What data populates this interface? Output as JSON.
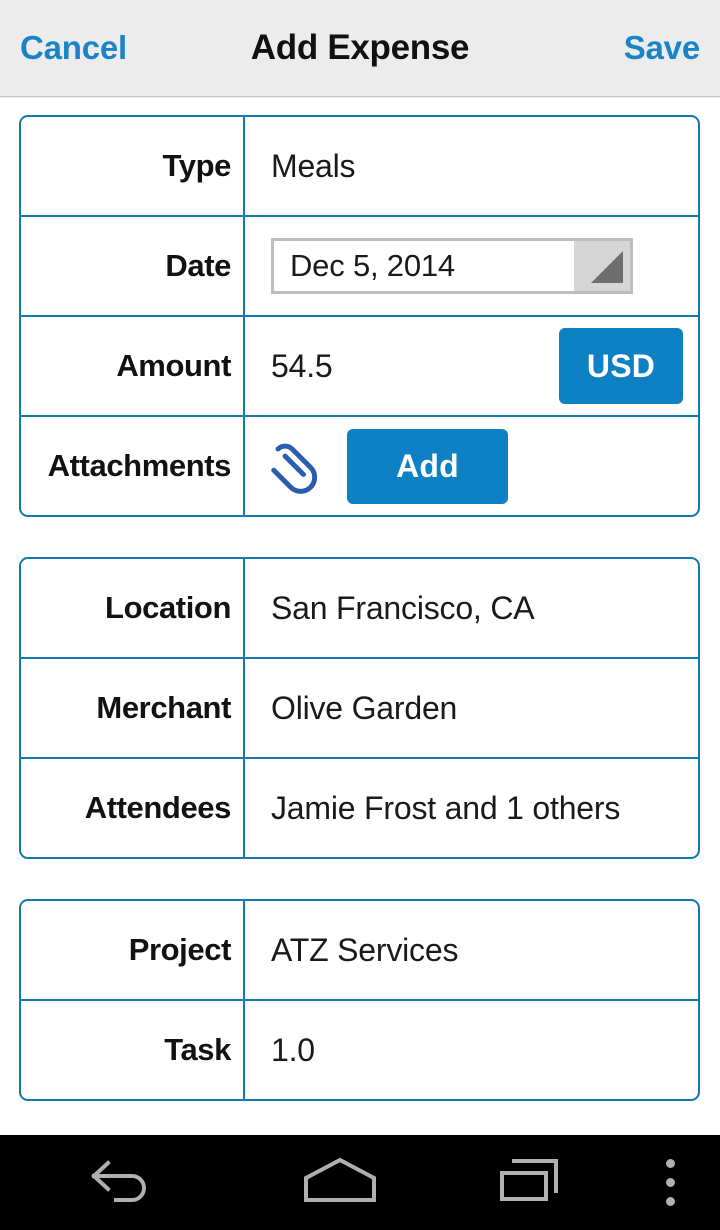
{
  "header": {
    "cancel_label": "Cancel",
    "title": "Add Expense",
    "save_label": "Save"
  },
  "colors": {
    "accent_blue": "#0d81c4",
    "border_blue": "#1378ad",
    "link_blue": "#1a84c7",
    "header_bg": "#ececec",
    "navbar_bg": "#000000"
  },
  "sections": [
    {
      "rows": [
        {
          "label": "Type",
          "value": "Meals"
        },
        {
          "label": "Date",
          "value": "Dec 5, 2014"
        },
        {
          "label": "Amount",
          "value": "54.5",
          "currency_label": "USD"
        },
        {
          "label": "Attachments",
          "value": "",
          "add_label": "Add",
          "icon": "paperclip-icon"
        }
      ]
    },
    {
      "rows": [
        {
          "label": "Location",
          "value": "San Francisco, CA"
        },
        {
          "label": "Merchant",
          "value": "Olive Garden"
        },
        {
          "label": "Attendees",
          "value": "Jamie Frost and 1 others"
        }
      ]
    },
    {
      "rows": [
        {
          "label": "Project",
          "value": "ATZ Services"
        },
        {
          "label": "Task",
          "value": "1.0"
        }
      ]
    }
  ],
  "navbar": {
    "back": "back-icon",
    "home": "home-icon",
    "recents": "recents-icon",
    "more": "overflow-menu-icon"
  }
}
